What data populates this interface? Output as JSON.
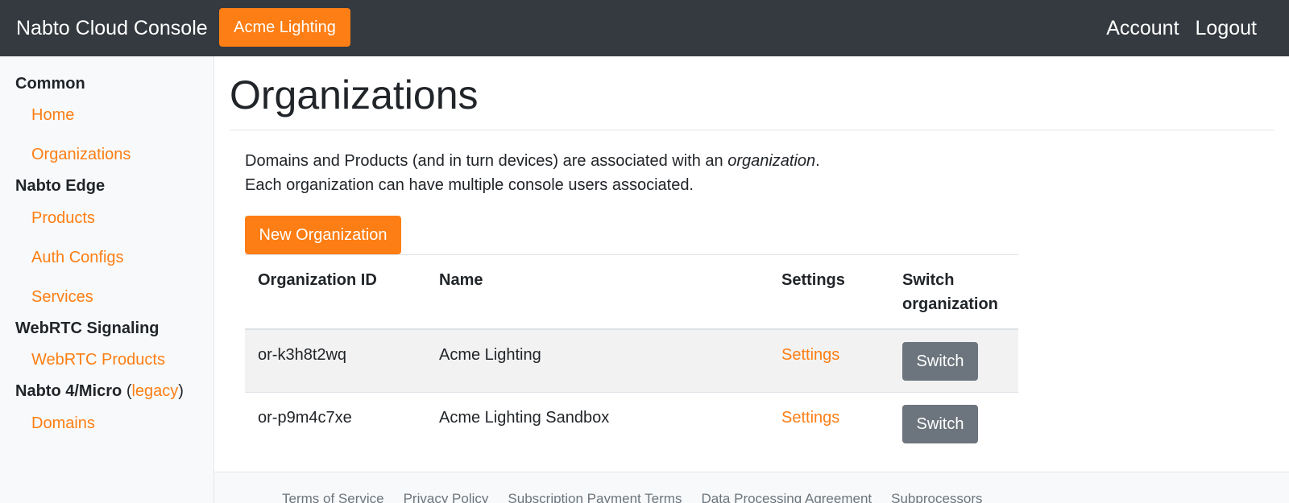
{
  "navbar": {
    "brand": "Nabto Cloud Console",
    "current_org": "Acme Lighting",
    "account": "Account",
    "logout": "Logout"
  },
  "sidebar": {
    "common": {
      "heading": "Common",
      "items": [
        "Home",
        "Organizations"
      ]
    },
    "edge": {
      "heading": "Nabto Edge",
      "items": [
        "Products",
        "Auth Configs",
        "Services"
      ]
    },
    "webrtc": {
      "heading": "WebRTC Signaling",
      "items": [
        "WebRTC Products"
      ]
    },
    "legacy": {
      "heading": "Nabto 4/Micro",
      "paren_open": "(",
      "legacy_link": "legacy",
      "paren_close": ")",
      "items": [
        "Domains"
      ]
    }
  },
  "main": {
    "title": "Organizations",
    "intro_part1": "Domains and Products (and in turn devices) are associated with an ",
    "intro_em": "organization",
    "intro_part2": ". Each organization can have multiple console users associated.",
    "new_button": "New Organization",
    "table": {
      "headers": [
        "Organization ID",
        "Name",
        "Settings",
        "Switch organization"
      ],
      "rows": [
        {
          "id": "or-k3h8t2wq",
          "name": "Acme Lighting",
          "settings": "Settings",
          "switch": "Switch"
        },
        {
          "id": "or-p9m4c7xe",
          "name": "Acme Lighting Sandbox",
          "settings": "Settings",
          "switch": "Switch"
        }
      ]
    }
  },
  "footer": {
    "links": [
      "Terms of Service",
      "Privacy Policy",
      "Subscription Payment Terms",
      "Data Processing Agreement",
      "Subprocessors"
    ]
  },
  "colors": {
    "navbar_bg": "#343a40",
    "accent": "#fd7e14",
    "switch_button": "#6c757d",
    "sidebar_bg": "#f8f9fa"
  }
}
